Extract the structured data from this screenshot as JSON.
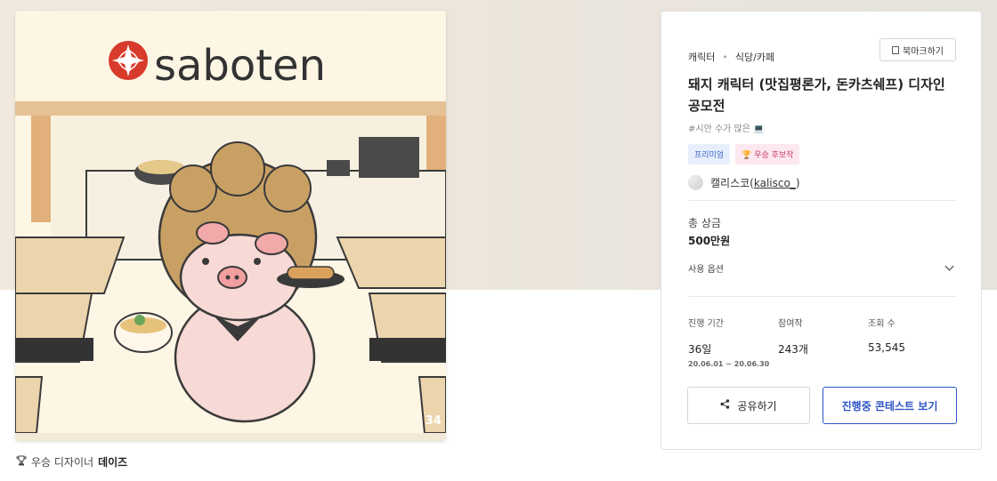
{
  "artwork": {
    "brand_text": "saboten",
    "like_count": "34"
  },
  "award_line": {
    "prefix": "우승 디자이너",
    "designer": "데이즈"
  },
  "panel": {
    "breadcrumb": [
      "캐릭터",
      "식당/카페"
    ],
    "bookmark_label": "북마크하기",
    "title": "돼지 캐릭터 (맛집평론가, 돈카츠쉐프) 디자인 공모전",
    "tagline": "#시안 수가 많은 💻",
    "badges": {
      "premium": "프리미엄",
      "award": "🏆 우승 후보작"
    },
    "author": {
      "name": "캘리스코",
      "handle": "kalisco_"
    },
    "prize_label": "총 상금",
    "prize_value": "500만원",
    "usage_label": "사용 옵션",
    "stats": {
      "period_label": "진행 기간",
      "period_value": "36일",
      "period_dates": "20.06.01 ~ 20.06.30",
      "entries_label": "참여작",
      "entries_value": "243개",
      "views_label": "조회 수",
      "views_value": "53,545"
    },
    "share_label": "공유하기",
    "contest_label": "진행중 콘테스트 보기"
  }
}
